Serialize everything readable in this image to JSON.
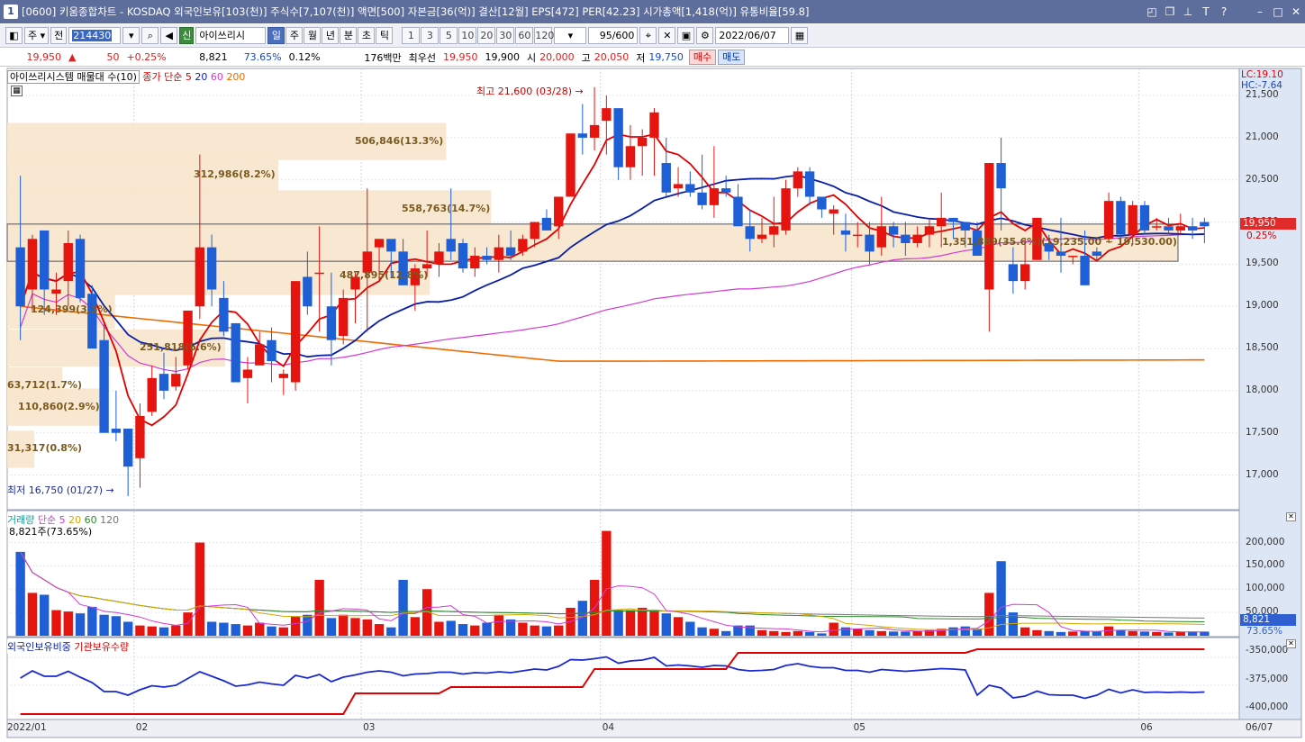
{
  "window": {
    "title": "[0600] 키움종합차트 - KOSDAQ 외국인보유[103(천)] 주식수[7,107(천)] 액면[500] 자본금[36(억)] 결산[12월] EPS[472] PER[42.23] 시가총액[1,418(억)] 유통비율[59.8]",
    "app_icon": "1"
  },
  "toolbar": {
    "period_select": "주",
    "prev_label": "전",
    "code": "214430",
    "stock_badge": "신",
    "stock_name": "아이쓰리시",
    "periods": [
      "일",
      "주",
      "월",
      "년",
      "분",
      "초",
      "틱"
    ],
    "active_period": "일",
    "intervals": [
      "1",
      "3",
      "5",
      "10",
      "20",
      "30",
      "60",
      "120"
    ],
    "count": "95/600",
    "date": "2022/06/07"
  },
  "quote": {
    "price": "19,950",
    "arrow": "▲",
    "change": "50",
    "change_pct": "+0.25%",
    "volume": "8,821",
    "vol_ratio": "73.65%",
    "turnover": "0.12%",
    "amount": "176백만",
    "best_label": "최우선",
    "best_ask": "19,950",
    "best_bid": "19,900",
    "open_label": "시",
    "open": "20,000",
    "high_label": "고",
    "high": "20,050",
    "low_label": "저",
    "low": "19,750",
    "buy_label": "매수",
    "sell_label": "매도"
  },
  "price_panel": {
    "legend_name": "아이쓰리시스템 매물대 수(10)",
    "legend_ma": "종가 단순",
    "legend_ma_periods": [
      "5",
      "20",
      "60",
      "200"
    ],
    "lc": "LC:19.10",
    "hc": "HC:-7.64",
    "current_tag": "19,950",
    "current_pct": "0.25%",
    "max_label": "최고 21,600 (03/28)",
    "min_label": "최저 16,750 (01/27)",
    "y_ticks": [
      "21,500",
      "21,000",
      "20,500",
      "20,000",
      "19,500",
      "19,000",
      "18,500",
      "18,000",
      "17,500",
      "17,000"
    ],
    "volume_profile": [
      {
        "label": "31,317(0.8%)",
        "price": 17300,
        "amount": 31317
      },
      {
        "label": "110,860(2.9%)",
        "price": 17800,
        "amount": 110860
      },
      {
        "label": "63,712(1.7%)",
        "price": 18050,
        "amount": 63712
      },
      {
        "label": "251,818(6.6%)",
        "price": 18500,
        "amount": 251818
      },
      {
        "label": "124,399(3.3%)",
        "price": 18950,
        "amount": 124399
      },
      {
        "label": "487,895(12.8%)",
        "price": 19350,
        "amount": 487895
      },
      {
        "label": "1,351,889(35.6%)(19,235.00 ~ 19,530.00)",
        "price": 19750,
        "amount": 1351889
      },
      {
        "label": "558,763(14.7%)",
        "price": 20150,
        "amount": 558763
      },
      {
        "label": "312,986(8.2%)",
        "price": 20550,
        "amount": 312986
      },
      {
        "label": "506,846(13.3%)",
        "price": 20950,
        "amount": 506846
      }
    ]
  },
  "volume_panel": {
    "legend_name": "거래량",
    "legend_ma": "단순",
    "legend_periods": [
      "5",
      "20",
      "60",
      "120"
    ],
    "current_label": "8,821주(73.65%)",
    "y_ticks": [
      "200,000",
      "150,000",
      "100,000",
      "50,000"
    ],
    "current_tag": "8,821",
    "current_pct": "73.65%"
  },
  "holding_panel": {
    "legend_foreign": "외국인보유비중",
    "legend_inst": "기관보유수량",
    "y_ticks": [
      "-350,000",
      "-375,000",
      "-400,000"
    ]
  },
  "x_axis": {
    "labels": [
      "2022/01",
      "02",
      "03",
      "04",
      "05",
      "06"
    ],
    "current": "06/07"
  },
  "colors": {
    "up": "#e5140f",
    "down": "#1f5fd6",
    "ma5": "#e00000",
    "ma20": "#0a1fa8",
    "ma60": "#d23ad2",
    "ma200": "#f06a00",
    "profile": "#f8e6cf"
  },
  "chart_data": {
    "type": "candlestick",
    "candles": [
      [
        19700,
        20550,
        18600,
        19000
      ],
      [
        19200,
        19850,
        18950,
        19800
      ],
      [
        19900,
        19800,
        18900,
        19200
      ],
      [
        19150,
        19400,
        18900,
        19200
      ],
      [
        19300,
        19900,
        19000,
        19750
      ],
      [
        19800,
        19850,
        19050,
        19100
      ],
      [
        19150,
        19250,
        18700,
        18500
      ],
      [
        18600,
        18800,
        17600,
        17500
      ],
      [
        17550,
        18000,
        17400,
        17500
      ],
      [
        17550,
        17550,
        16750,
        17100
      ],
      [
        17200,
        17850,
        16850,
        17700
      ],
      [
        17750,
        18300,
        17700,
        18150
      ],
      [
        18200,
        18450,
        17900,
        18000
      ],
      [
        18050,
        18400,
        18000,
        18200
      ],
      [
        18300,
        18450,
        18250,
        18950
      ],
      [
        19000,
        20800,
        18850,
        19700
      ],
      [
        19700,
        19850,
        19000,
        19200
      ],
      [
        19100,
        19300,
        18650,
        18700
      ],
      [
        18800,
        18800,
        18100,
        18100
      ],
      [
        18150,
        18400,
        17850,
        18250
      ],
      [
        18300,
        18700,
        18300,
        18550
      ],
      [
        18600,
        18750,
        18100,
        18350
      ],
      [
        18150,
        18250,
        17950,
        18200
      ],
      [
        18100,
        19050,
        18000,
        19300
      ],
      [
        19350,
        19650,
        18900,
        19000
      ],
      [
        19400,
        19950,
        18700,
        19400
      ],
      [
        19000,
        19400,
        18300,
        18600
      ],
      [
        18650,
        19200,
        18550,
        19100
      ],
      [
        19200,
        19400,
        18800,
        19350
      ],
      [
        19400,
        20400,
        18700,
        19650
      ],
      [
        19700,
        19800,
        19300,
        19800
      ],
      [
        19800,
        19650,
        19350,
        19650
      ],
      [
        19650,
        19800,
        19400,
        19250
      ],
      [
        19250,
        19500,
        18950,
        19450
      ],
      [
        19450,
        19900,
        19350,
        19500
      ],
      [
        19500,
        19750,
        19350,
        19650
      ],
      [
        19800,
        20400,
        19550,
        19650
      ],
      [
        19750,
        19800,
        19400,
        19450
      ],
      [
        19450,
        19700,
        19350,
        19600
      ],
      [
        19600,
        19700,
        19500,
        19550
      ],
      [
        19550,
        19850,
        19400,
        19700
      ],
      [
        19700,
        19900,
        19550,
        19600
      ],
      [
        19650,
        19850,
        19600,
        19800
      ],
      [
        19800,
        20000,
        19700,
        20000
      ],
      [
        20050,
        20150,
        19950,
        19900
      ],
      [
        19950,
        20300,
        19800,
        20300
      ],
      [
        20300,
        21050,
        20300,
        21050
      ],
      [
        21050,
        21400,
        20800,
        21000
      ],
      [
        21000,
        21600,
        20850,
        21150
      ],
      [
        21200,
        21500,
        20800,
        21350
      ],
      [
        21350,
        21300,
        20500,
        20650
      ],
      [
        20650,
        21150,
        20500,
        20900
      ],
      [
        20900,
        21100,
        20550,
        21000
      ],
      [
        21000,
        21350,
        20550,
        21300
      ],
      [
        20700,
        21000,
        20300,
        20350
      ],
      [
        20400,
        20650,
        20300,
        20450
      ],
      [
        20450,
        20600,
        20300,
        20350
      ],
      [
        20350,
        20800,
        20150,
        20200
      ],
      [
        20200,
        20900,
        20050,
        20400
      ],
      [
        20400,
        20550,
        20300,
        20350
      ],
      [
        20300,
        20450,
        19950,
        19950
      ],
      [
        19950,
        20150,
        19650,
        19800
      ],
      [
        19800,
        20050,
        19750,
        19850
      ],
      [
        19850,
        20300,
        19700,
        19950
      ],
      [
        19900,
        20500,
        19850,
        20400
      ],
      [
        20400,
        20650,
        20300,
        20600
      ],
      [
        20600,
        20650,
        20200,
        20300
      ],
      [
        20300,
        20300,
        20050,
        20150
      ],
      [
        20100,
        20200,
        19850,
        20150
      ],
      [
        19900,
        20100,
        19650,
        19850
      ],
      [
        19850,
        20000,
        19700,
        19850
      ],
      [
        19850,
        20000,
        19500,
        19650
      ],
      [
        19700,
        20300,
        19600,
        19950
      ],
      [
        19950,
        20000,
        19700,
        19850
      ],
      [
        19850,
        20000,
        19600,
        19750
      ],
      [
        19750,
        19950,
        19700,
        19850
      ],
      [
        19850,
        20050,
        19700,
        19950
      ],
      [
        19950,
        20350,
        19700,
        20050
      ],
      [
        20050,
        20000,
        19800,
        20000
      ],
      [
        20000,
        20000,
        19700,
        19900
      ],
      [
        19900,
        20000,
        19650,
        19600
      ],
      [
        19200,
        20700,
        18700,
        20700
      ],
      [
        20700,
        21000,
        19900,
        20400
      ],
      [
        19500,
        19700,
        19150,
        19300
      ],
      [
        19300,
        19800,
        19200,
        19500
      ],
      [
        19550,
        20050,
        19550,
        20050
      ],
      [
        19750,
        19850,
        19550,
        19650
      ],
      [
        19650,
        20050,
        19400,
        19600
      ],
      [
        19600,
        19600,
        19500,
        19600
      ],
      [
        19600,
        19900,
        19250,
        19250
      ],
      [
        19650,
        19700,
        19550,
        19600
      ],
      [
        19800,
        20350,
        19750,
        20250
      ],
      [
        20250,
        20300,
        19750,
        19850
      ],
      [
        19850,
        20250,
        19750,
        20200
      ],
      [
        20200,
        20250,
        19850,
        19900
      ],
      [
        19950,
        20050,
        19900,
        19950
      ],
      [
        19950,
        20050,
        19850,
        19900
      ],
      [
        19900,
        20100,
        19850,
        19950
      ],
      [
        19950,
        20050,
        19800,
        19900
      ],
      [
        20000,
        20050,
        19750,
        19950
      ]
    ],
    "volume": [
      180000,
      92000,
      88000,
      55000,
      52000,
      48000,
      62000,
      45000,
      42000,
      30000,
      22000,
      20000,
      18000,
      22000,
      50000,
      200000,
      30000,
      28000,
      25000,
      22000,
      28000,
      20000,
      18000,
      42000,
      45000,
      120000,
      38000,
      45000,
      38000,
      35000,
      25000,
      18000,
      120000,
      40000,
      100000,
      30000,
      32000,
      25000,
      22000,
      28000,
      45000,
      35000,
      28000,
      22000,
      20000,
      22000,
      60000,
      75000,
      120000,
      225000,
      55000,
      55000,
      60000,
      52000,
      48000,
      40000,
      30000,
      18000,
      15000,
      10000,
      22000,
      22000,
      12000,
      10000,
      8000,
      10000,
      8000,
      5000,
      28000,
      18000,
      15000,
      12000,
      10000,
      9000,
      9000,
      10000,
      12000,
      15000,
      18000,
      20000,
      15000,
      92000,
      160000,
      50000,
      18000,
      12000,
      10000,
      8000,
      9000,
      10000,
      9000,
      20000,
      12000,
      10000,
      9000,
      8000,
      7000,
      8000,
      9000,
      8821
    ]
  }
}
